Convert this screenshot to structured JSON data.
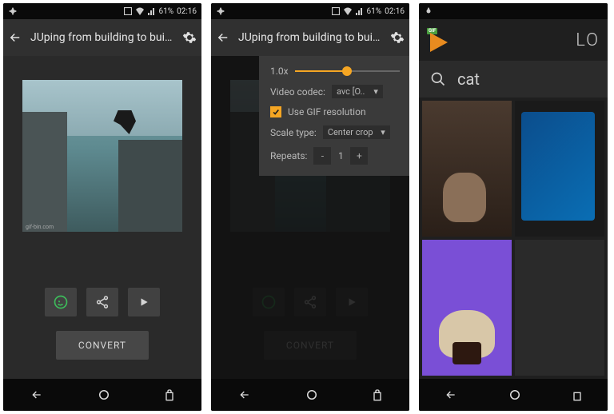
{
  "status": {
    "battery_pct": "61%",
    "time": "02:16",
    "signal_icon": "signal-icon",
    "wifi_icon": "wifi-icon",
    "battery_icon": "battery-icon"
  },
  "screen1": {
    "title": "JUping from building to buil…",
    "watermark": "gif-bin.com",
    "convert_label": "CONVERT"
  },
  "screen2": {
    "title": "JUping from building to buil…",
    "settings": {
      "speed_label": "1.0x",
      "codec_label": "Video codec:",
      "codec_value": "avc [O..",
      "use_gif_res_label": "Use GIF resolution",
      "use_gif_res_checked": true,
      "scale_label": "Scale type:",
      "scale_value": "Center crop",
      "repeats_label": "Repeats:",
      "repeats_value": "1"
    },
    "convert_label": "CONVERT"
  },
  "screen3": {
    "brand_partial": "LO",
    "gif_badge": "GIF",
    "search_value": "cat"
  },
  "icons": {
    "back": "←",
    "settings_gear": "⚙",
    "minus": "-",
    "plus": "+",
    "caret": "▾",
    "search": "🔍"
  }
}
